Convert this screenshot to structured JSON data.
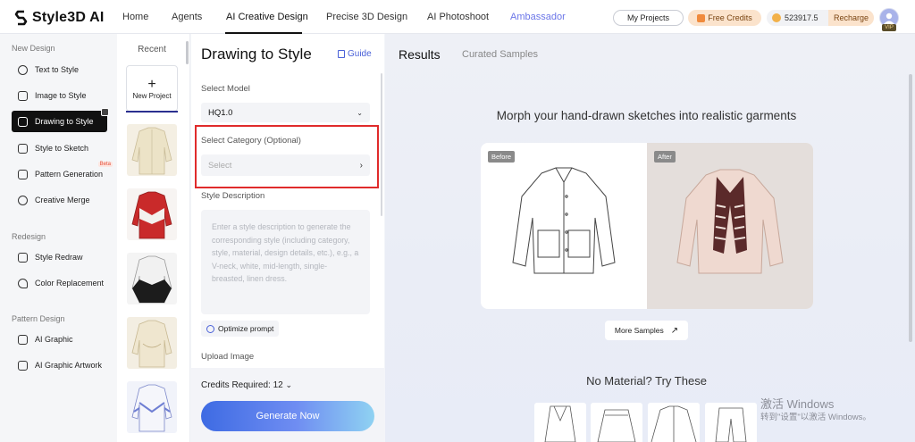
{
  "app": {
    "logo_text": "Style3D AI"
  },
  "nav": {
    "items": [
      "Home",
      "Agents",
      "AI Creative Design",
      "Precise 3D Design",
      "AI Photoshoot",
      "Ambassador"
    ],
    "active": "AI Creative Design"
  },
  "header": {
    "my_projects": "My Projects",
    "free_credits": "Free Credits",
    "credit_balance": "523917.5",
    "recharge": "Recharge",
    "vip_badge": "VIP"
  },
  "sidebar": {
    "sections": [
      {
        "title": "New Design",
        "items": [
          "Text to Style",
          "Image to Style",
          "Drawing to Style",
          "Style to Sketch",
          "Pattern Generation",
          "Creative Merge"
        ]
      },
      {
        "title": "Redesign",
        "items": [
          "Style Redraw",
          "Color Replacement"
        ]
      },
      {
        "title": "Pattern Design",
        "items": [
          "AI Graphic",
          "AI Graphic Artwork"
        ]
      }
    ],
    "active_item": "Drawing to Style",
    "beta_label": "Beta"
  },
  "recent": {
    "title": "Recent",
    "new_project": "New Project"
  },
  "panel": {
    "title": "Drawing to Style",
    "guide": "Guide",
    "model_label": "Select Model",
    "model_value": "HQ1.0",
    "category_label": "Select Category (Optional)",
    "category_placeholder": "Select",
    "description_label": "Style Description",
    "description_placeholder": "Enter a style description to generate the corresponding style (including category, style, material, design details, etc.), e.g., a V-neck, white, mid-length, single-breasted, linen dress.",
    "optimize": "Optimize prompt",
    "upload_label": "Upload Image",
    "credits_required": "Credits Required: 12",
    "generate": "Generate Now"
  },
  "main": {
    "tabs": [
      "Results",
      "Curated Samples"
    ],
    "active_tab": "Results",
    "headline": "Morph your hand-drawn sketches into realistic garments",
    "before_tag": "Before",
    "after_tag": "After",
    "more_samples": "More Samples",
    "no_material": "No Material? Try These"
  },
  "watermark": {
    "line1": "激活 Windows",
    "line2": "转到\"设置\"以激活 Windows。"
  }
}
